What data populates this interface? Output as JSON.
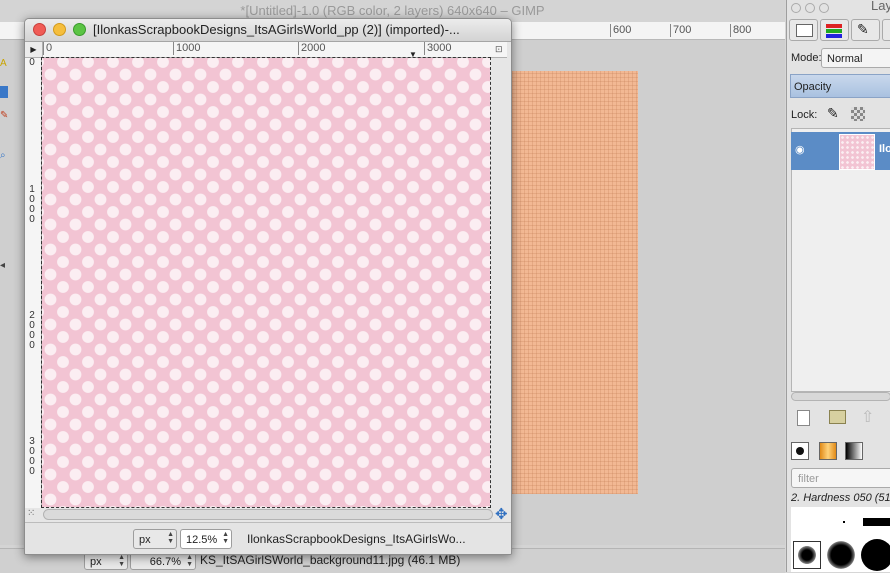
{
  "background_window": {
    "title": "*[Untitled]-1.0 (RGB color, 2 layers) 640x640 – GIMP",
    "ruler_ticks": [
      "600",
      "700",
      "800"
    ],
    "status": {
      "unit": "px",
      "zoom": "66.7%",
      "file_info": "KS_ItSAGirlSWorld_background11.jpg (46.1 MB)"
    }
  },
  "image_window": {
    "title": "[IlonkasScrapbookDesigns_ItsAGirlsWorld_pp (2)] (imported)-...",
    "h_ruler_ticks": [
      "0",
      "1000",
      "2000",
      "3000"
    ],
    "v_ruler_ticks": [
      "0",
      "1\n0\n0\n0",
      "2\n0\n0\n0",
      "3\n0\n0\n0"
    ],
    "status": {
      "unit": "px",
      "zoom": "12.5%",
      "file_name": "IlonkasScrapbookDesigns_ItsAGirlsWo..."
    }
  },
  "layers_dock": {
    "title": "Layer",
    "mode_label": "Mode:",
    "mode_value": "Normal",
    "opacity_label": "Opacity",
    "lock_label": "Lock:",
    "layer_name": "Ilo",
    "brushes_filter_placeholder": "filter",
    "brush_name": "2. Hardness 050 (51"
  },
  "colors": {
    "pink_paper": "#f2c4d3",
    "dot": "#fbeef2",
    "woven_background": "#f2b893",
    "layer_selected": "#5b8cc6"
  }
}
